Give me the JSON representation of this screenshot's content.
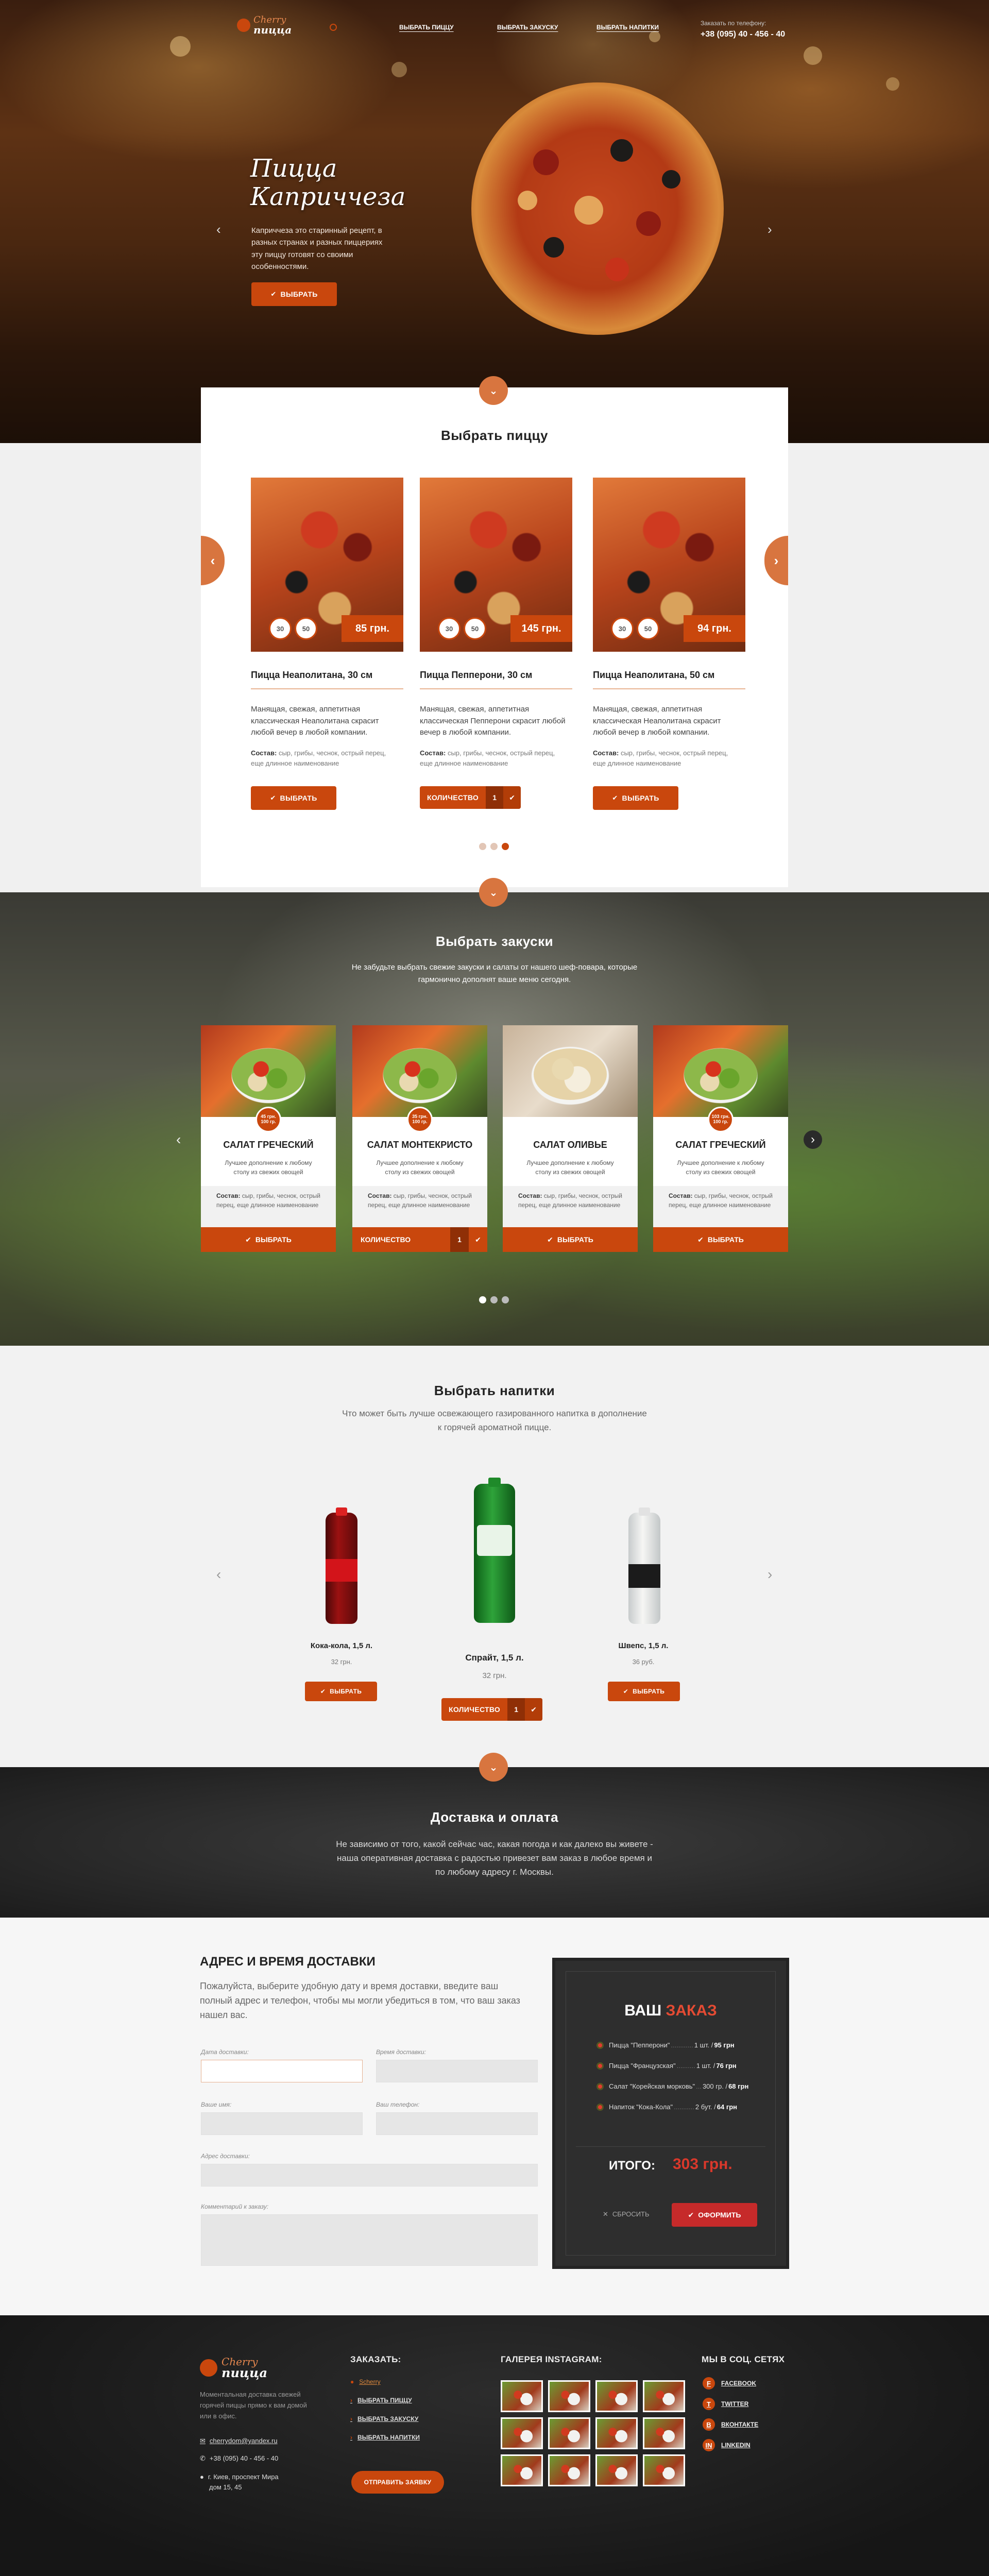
{
  "header": {
    "logo_top": "Cherry",
    "logo_bottom": "пицца",
    "nav": [
      "Выбрать пиццу",
      "Выбрать закуску",
      "Выбрать напитки"
    ],
    "phone_label": "Заказать по телефону:",
    "phone": "+38 (095) 40 - 456 - 40"
  },
  "hero": {
    "title_line1": "Пицца",
    "title_line2": "Каприччеза",
    "desc": "Каприччеза это старинный рецепт, в разных странах и разных пиццериях эту пиццу готовят со своими особенностями.",
    "button": "Выбрать"
  },
  "pizzas": {
    "title": "Выбрать пиццу",
    "items": [
      {
        "name": "Пицца Неаполитана, 30 см",
        "sizes": [
          "30",
          "50"
        ],
        "price": "85 грн.",
        "desc": "Манящая, свежая, аппетитная классическая Неаполитана скрасит любой вечер в любой компании.",
        "comp_label": "Состав:",
        "comp": "сыр, грибы, чеснок, острый перец, еще длинное наименование",
        "button": "Выбрать"
      },
      {
        "name": "Пицца Пепперони, 30 см",
        "sizes": [
          "30",
          "50"
        ],
        "price": "145 грн.",
        "desc": "Манящая, свежая, аппетитная классическая Пепперони скрасит любой вечер в любой компании.",
        "comp_label": "Состав:",
        "comp": "сыр, грибы, чеснок, острый перец, еще длинное наименование",
        "qty_label": "Количество",
        "qty": "1"
      },
      {
        "name": "Пицца Неаполитана, 50 см",
        "sizes": [
          "30",
          "50"
        ],
        "price": "94 грн.",
        "desc": "Манящая, свежая, аппетитная классическая Неаполитана скрасит любой вечер в любой компании.",
        "comp_label": "Состав:",
        "comp": "сыр, грибы, чеснок, острый перец, еще длинное наименование",
        "button": "Выбрать"
      }
    ]
  },
  "snacks": {
    "title": "Выбрать закуски",
    "subtitle": "Не забудьте выбрать свежие закуски и салаты от нашего шеф-повара, которые гармонично дополнят ваше меню сегодня.",
    "items": [
      {
        "name": "Салат греческий",
        "badge_price": "45 грн.",
        "badge_weight": "100 гр.",
        "desc": "Лучшее дополнение к любому столу из свежих овощей",
        "comp_label": "Состав:",
        "comp": "сыр, грибы, чеснок, острый перец, еще длинное наименование",
        "button": "Выбрать"
      },
      {
        "name": "Салат Монтекристо",
        "badge_price": "35 грн.",
        "badge_weight": "100 гр.",
        "desc": "Лучшее дополнение к любому столу из свежих овощей",
        "comp_label": "Состав:",
        "comp": "сыр, грибы, чеснок, острый перец, еще длинное наименование",
        "qty_label": "Количество",
        "qty": "1"
      },
      {
        "name": "Салат Оливье",
        "badge_price": "",
        "badge_weight": "",
        "desc": "Лучшее дополнение к любому столу из свежих овощей",
        "comp_label": "Состав:",
        "comp": "сыр, грибы, чеснок, острый перец, еще длинное наименование",
        "button": "Выбрать"
      },
      {
        "name": "Салат греческий",
        "badge_price": "103 грн.",
        "badge_weight": "100 гр.",
        "desc": "Лучшее дополнение к любому столу из свежих овощей",
        "comp_label": "Состав:",
        "comp": "сыр, грибы, чеснок, острый перец, еще длинное наименование",
        "button": "Выбрать"
      }
    ]
  },
  "drinks": {
    "title": "Выбрать напитки",
    "subtitle": "Что может быть лучше освежающего газированного напитка в дополнение к горячей ароматной пицце.",
    "items": [
      {
        "name": "Кока-кола, 1,5 л.",
        "price": "32 грн.",
        "button": "Выбрать"
      },
      {
        "name": "Спрайт, 1,5 л.",
        "price": "32 грн.",
        "qty_label": "Количество",
        "qty": "1"
      },
      {
        "name": "Швепс, 1,5 л.",
        "price": "36 руб.",
        "button": "Выбрать"
      }
    ]
  },
  "delivery": {
    "title": "Доставка и оплата",
    "text": "Не зависимо от того, какой сейчас час, какая погода и как далеко вы живете - наша оперативная доставка с радостью привезет вам заказ в любое время и по любому адресу г. Москвы."
  },
  "form": {
    "title": "Адрес и время доставки",
    "intro": "Пожалуйста, выберите удобную дату и время доставки, введите ваш полный адрес и телефон, чтобы мы могли убедиться в том, что ваш заказ нашел вас.",
    "labels": {
      "date": "Дата доставки:",
      "time": "Время доставки:",
      "name": "Ваше имя:",
      "phone": "Ваш телефон:",
      "address": "Адрес доставки:",
      "comment": "Комментарий к заказу:"
    }
  },
  "order": {
    "title_a": "Ваш",
    "title_b": "заказ",
    "items": [
      {
        "name": "Пицца \"Пепперони\"",
        "dots": "............",
        "qty": "1 шт. / ",
        "price": "95 грн"
      },
      {
        "name": "Пицца \"Французская\"",
        "dots": "..........",
        "qty": "1 шт. / ",
        "price": "76 грн"
      },
      {
        "name": "Салат \"Корейская морковь\"",
        "dots": "...",
        "qty": "300 гр. / ",
        "price": "68 грн"
      },
      {
        "name": "Напиток \"Кока-Кола\"",
        "dots": "...........",
        "qty": "2 бут. / ",
        "price": "64 грн"
      }
    ],
    "total_label": "Итого:",
    "total": "303 грн.",
    "reset": "Сбросить",
    "submit": "Оформить"
  },
  "footer": {
    "logo_top": "Cherry",
    "logo_bottom": "пицца",
    "about": "Моментальная доставка свежей горячей пиццы прямо к вам домой или в офис.",
    "email": "cherrydom@yandex.ru",
    "phone": "+38 (095) 40 - 456 - 40",
    "address_line1": "г. Киев, проспект Мира",
    "address_line2": "дом 15, 45",
    "order_title": "Заказать:",
    "order_links": [
      "Scherry",
      "Выбрать пиццу",
      "Выбрать закуску",
      "Выбрать напитки"
    ],
    "order_button": "Отправить заявку",
    "gallery_title": "Галерея Instagram:",
    "social_title": "Мы в соц. сетях",
    "social": [
      {
        "icon": "facebook-icon",
        "glyph": "f",
        "label": "Facebook"
      },
      {
        "icon": "twitter-icon",
        "glyph": "t",
        "label": "Twitter"
      },
      {
        "icon": "vk-icon",
        "glyph": "в",
        "label": "Вконтакте"
      },
      {
        "icon": "linkedin-icon",
        "glyph": "in",
        "label": "LinkedIn"
      }
    ]
  },
  "colors": {
    "accent": "#c9470d",
    "accent_light": "#d8753f",
    "dark": "#262626",
    "total": "#d9382b"
  }
}
